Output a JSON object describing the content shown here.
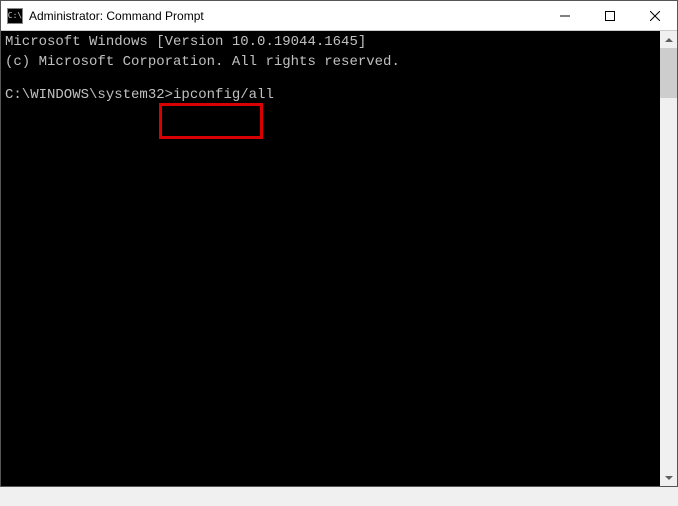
{
  "window": {
    "title": "Administrator: Command Prompt",
    "icon_text": "C:\\"
  },
  "terminal": {
    "line1": "Microsoft Windows [Version 10.0.19044.1645]",
    "line2": "(c) Microsoft Corporation. All rights reserved.",
    "prompt": "C:\\WINDOWS\\system32>",
    "command": "ipconfig/all"
  }
}
